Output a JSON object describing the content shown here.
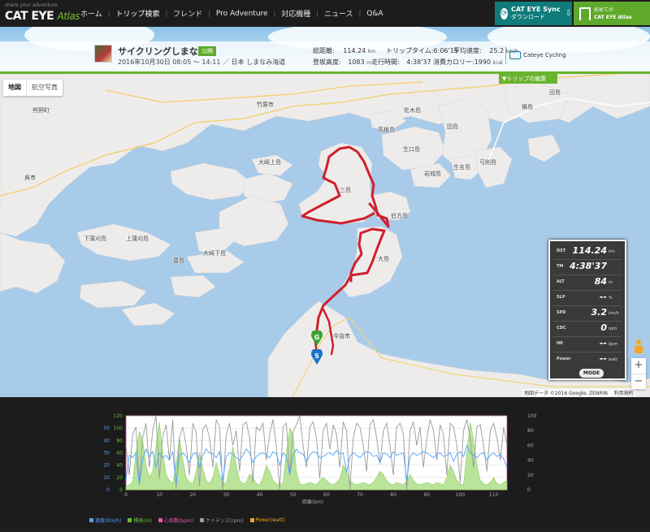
{
  "header": {
    "logo_tagline": "share your adventure.",
    "logo_text": "CAT EYE",
    "logo_suffix": "Atlas",
    "nav": [
      "ホーム",
      "トリップ検索",
      "フレンド",
      "Pro Adventure",
      "対応機種",
      "ニュース",
      "Q&A"
    ],
    "active_nav": "トリップ検索",
    "sync_button": {
      "title": "CAT EYE Sync",
      "subtitle": "ダウンロード"
    },
    "atlas_button": {
      "line1": "初めての",
      "line2": "CAT EYE Atlas"
    }
  },
  "trip": {
    "title": "サイクリングしまなみ",
    "visibility": "公開",
    "date": "2016年10月30日 08:05 ～ 14:11 ／ 日本 しまなみ海道",
    "stats": {
      "distance_label": "総距離:",
      "distance_value": "114.24",
      "distance_unit": "km",
      "trip_time_label": "トリップタイム:",
      "trip_time_value": "6:06'15",
      "avg_speed_label": "平均速度:",
      "avg_speed_value": "25.2",
      "avg_speed_unit": "km/h",
      "elevation_label": "登坂高度:",
      "elevation_value": "1083",
      "elevation_unit": "m",
      "ride_time_label": "走行時間:",
      "ride_time_value": "4:38'37",
      "calories_label": "消費カロリー:",
      "calories_value": "1990",
      "calories_unit": "kcal"
    },
    "device": "Cateye Cycling"
  },
  "map": {
    "type_options": [
      "地図",
      "航空写真"
    ],
    "selected_type": "地図",
    "edit_button": "▼トリップの編集",
    "places": [
      "竹原市",
      "呉市",
      "大崎上島",
      "三島",
      "生口島",
      "岩城島",
      "佐木島",
      "高根島",
      "因島",
      "伯方島",
      "大島",
      "生名島",
      "弓削島",
      "今治市",
      "下蒲刈島",
      "上蒲刈島",
      "大崎下島",
      "豊島",
      "熊野町",
      "田島",
      "横島"
    ],
    "google_logo": "Google",
    "attribution": "地図データ ©2016 Google, ZENRIN",
    "terms": "利用規約",
    "start_marker": "S",
    "goal_marker": "G"
  },
  "meter": {
    "rows": [
      {
        "label": "DST",
        "value": "114.24",
        "unit": "km"
      },
      {
        "label": "TM",
        "value": "4:38'37",
        "unit": ""
      },
      {
        "label": "ALT",
        "value": "84",
        "unit": "m"
      },
      {
        "label": "SLP",
        "value": "--",
        "unit": "%"
      },
      {
        "label": "SPD",
        "value": "3.2",
        "unit": "km/h"
      },
      {
        "label": "CDC",
        "value": "0",
        "unit": "rpm"
      },
      {
        "label": "HR",
        "value": "--",
        "unit": "bpm"
      },
      {
        "label": "Power",
        "value": "--",
        "unit": "watt"
      }
    ],
    "mode_label": "MODE"
  },
  "chart_data": {
    "type": "line",
    "xlabel": "距離(km)",
    "x_ticks": [
      0,
      10,
      20,
      30,
      40,
      50,
      60,
      70,
      80,
      90,
      100,
      110
    ],
    "xlim": [
      0,
      114
    ],
    "left_y_ticks": [
      0,
      10,
      20,
      30,
      40,
      50
    ],
    "left_ylim": [
      0,
      60
    ],
    "mid_y_ticks": [
      0,
      20,
      40,
      60,
      80,
      100,
      120
    ],
    "mid_ylim": [
      0,
      120
    ],
    "right_y_ticks": [
      0,
      20,
      40,
      60,
      80,
      100
    ],
    "right_ylim": [
      0,
      100
    ],
    "series": [
      {
        "name": "速度(Km/h)",
        "color": "#4da3ff",
        "axis": "left",
        "values": [
          8,
          28,
          26,
          30,
          4,
          25,
          33,
          27,
          31,
          18,
          30,
          26,
          28,
          24,
          31,
          5,
          28,
          30,
          27,
          22,
          29,
          30,
          18,
          28,
          33,
          30,
          29,
          26,
          31,
          8,
          27,
          30,
          29,
          26,
          24,
          28,
          33,
          30,
          22,
          27,
          29,
          30,
          28,
          26,
          31,
          29,
          20,
          30,
          27,
          12,
          28,
          33,
          30,
          29,
          23,
          28,
          31,
          30,
          26,
          27,
          29,
          30,
          28,
          32,
          29,
          30,
          14,
          27,
          30,
          28,
          26,
          29,
          31,
          30,
          27,
          28,
          22,
          30,
          29,
          26,
          31,
          28,
          29,
          30,
          8,
          27,
          30,
          28,
          29,
          31,
          30,
          28,
          26,
          29,
          30,
          27,
          28,
          30,
          23,
          29,
          31,
          27,
          36,
          30,
          28,
          26,
          29,
          30,
          24,
          28,
          30,
          27,
          29,
          25,
          18
        ]
      },
      {
        "name": "標高(m)",
        "color": "#6bbf3a",
        "axis": "mid",
        "values": [
          5,
          8,
          12,
          60,
          95,
          80,
          40,
          20,
          30,
          70,
          110,
          60,
          25,
          15,
          10,
          40,
          85,
          50,
          20,
          12,
          10,
          30,
          60,
          35,
          15,
          10,
          20,
          45,
          25,
          12,
          10,
          35,
          70,
          40,
          15,
          10,
          12,
          25,
          20,
          10,
          8,
          20,
          40,
          30,
          15,
          10,
          8,
          12,
          60,
          100,
          90,
          30,
          10,
          8,
          10,
          12,
          10,
          8,
          15,
          20,
          15,
          10,
          8,
          12,
          18,
          40,
          30,
          15,
          10,
          8,
          10,
          12,
          10,
          8,
          12,
          20,
          30,
          25,
          15,
          10,
          8,
          12,
          10,
          8,
          15,
          25,
          15,
          10,
          8,
          10,
          12,
          10,
          8,
          12,
          10,
          8,
          20,
          40,
          30,
          15,
          10,
          8,
          60,
          110,
          80,
          40,
          15,
          10,
          8,
          12,
          20,
          10,
          8,
          12,
          15
        ]
      },
      {
        "name": "心拍数(bpm)",
        "color": "#e85aa8",
        "axis": "right",
        "values": []
      },
      {
        "name": "ケイデンス(rpm)",
        "color": "#9a9a9a",
        "axis": "right",
        "values": [
          60,
          20,
          75,
          85,
          10,
          70,
          90,
          30,
          80,
          100,
          15,
          72,
          88,
          40,
          95,
          0,
          70,
          85,
          60,
          20,
          90,
          78,
          5,
          82,
          88,
          70,
          30,
          95,
          85,
          0,
          75,
          90,
          60,
          80,
          25,
          88,
          92,
          70,
          10,
          85,
          80,
          90,
          40,
          75,
          95,
          60,
          0,
          85,
          90,
          20,
          78,
          88,
          100,
          60,
          30,
          85,
          92,
          70,
          15,
          80,
          90,
          55,
          88,
          75,
          30,
          92,
          80,
          0,
          70,
          90,
          85,
          60,
          25,
          88,
          95,
          70,
          35,
          80,
          90,
          60,
          20,
          85,
          90,
          75,
          0,
          80,
          92,
          60,
          85,
          30,
          70,
          95,
          80,
          40,
          88,
          75,
          20,
          90,
          85,
          60,
          10,
          80,
          95,
          70,
          30,
          85,
          88,
          60,
          25,
          80,
          90,
          70,
          40,
          85,
          60
        ]
      },
      {
        "name": "Power(watt)",
        "color": "#f5a623",
        "axis": "right",
        "values": []
      }
    ]
  }
}
